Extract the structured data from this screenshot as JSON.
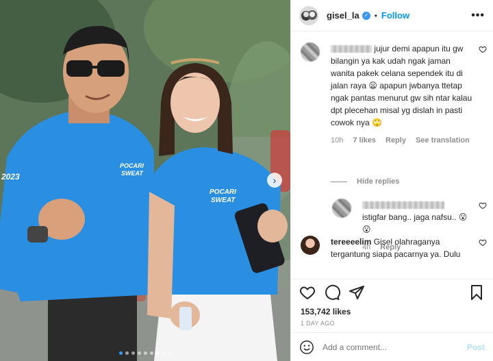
{
  "post": {
    "username": "gisel_la",
    "follow_label": "Follow",
    "separator": "•",
    "more_label": "•••",
    "carousel_dots": 9,
    "active_dot": 0
  },
  "photo": {
    "shirt_text_1": "POCARI\nSWEAT",
    "shirt_text_2": "POCARI\nSWEAT",
    "sleeve_text": "2023"
  },
  "comments": [
    {
      "username_hidden": true,
      "text": "jujur demi apapun itu gw bilangin ya kak udah ngak jaman wanita pakek celana sependek itu di jalan raya 😦 apapun jwbanya ttetap ngak pantas menurut gw sih ntar kalau dpt plecehan misal yg dislah in pasti cowok nya 🙄",
      "time": "10h",
      "likes": "7 likes",
      "reply": "Reply",
      "translate": "See translation"
    },
    {
      "username_hidden": true,
      "text": "istigfar bang.. jaga nafsu.. 😮😮",
      "time": "4h",
      "reply": "Reply"
    },
    {
      "username": "tereeeelim",
      "text": "Gisel olahraganya tergantung siapa pacarnya ya. Dulu"
    }
  ],
  "hide_replies": "Hide replies",
  "likes_count": "153,742 likes",
  "date": "1 DAY AGO",
  "add_comment": {
    "placeholder": "Add a comment...",
    "post_label": "Post"
  },
  "colors": {
    "link_blue": "#0095f6",
    "shirt_blue": "#2a8fe0",
    "post_disabled": "#b2dffc"
  }
}
